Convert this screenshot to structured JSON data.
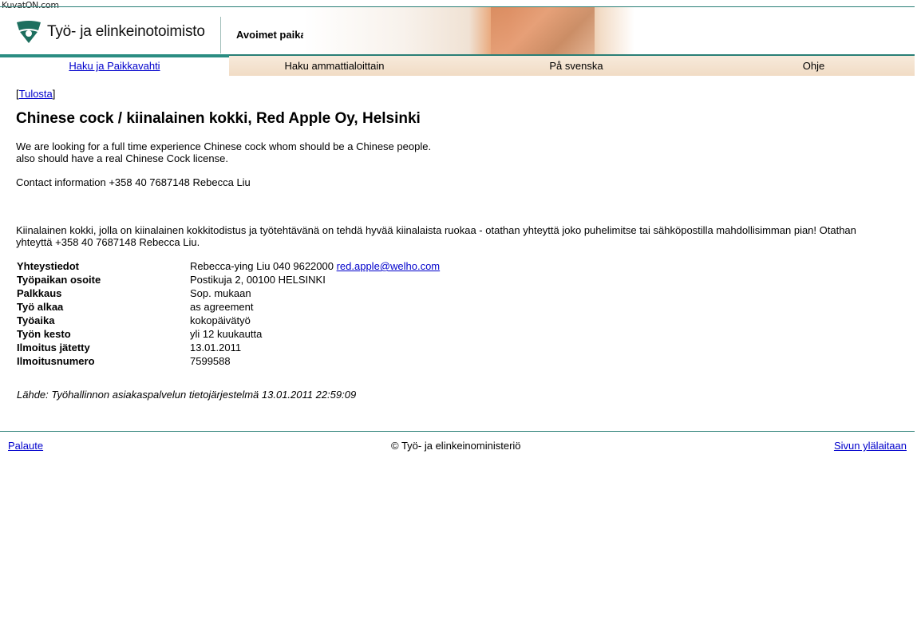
{
  "watermark": "KuvatON.com",
  "header": {
    "org_name": "Työ- ja elinkeinotoimisto",
    "section_title": "Avoimet paikat"
  },
  "nav": [
    {
      "label": "Haku ja Paikkavahti",
      "active": true
    },
    {
      "label": "Haku ammattialoittain",
      "active": false
    },
    {
      "label": "På svenska",
      "active": false
    },
    {
      "label": "Ohje",
      "active": false
    }
  ],
  "print": {
    "open": "[",
    "label": "Tulosta",
    "close": "]"
  },
  "title": "Chinese cock / kiinalainen kokki, Red Apple Oy, Helsinki",
  "description": {
    "line1": "We are looking for a full time experience Chinese cock whom should be a Chinese people.",
    "line2": "also should have a real Chinese Cock license.",
    "contact": "Contact information +358 40 7687148 Rebecca Liu",
    "finnish_line1": "Kiinalainen kokki, jolla on kiinalainen kokkitodistus ja työtehtävänä on tehdä hyvää kiinalaista ruokaa - otathan yhteyttä joko puhelimitse tai sähköpostilla mahdollisimman pian! Otathan",
    "finnish_line2": "yhteyttä +358 40 7687148 Rebecca Liu."
  },
  "details": {
    "contact_label": "Yhteystiedot",
    "contact_value": "Rebecca-ying Liu 040 9622000 ",
    "contact_email": "red.apple@welho.com",
    "rows": [
      {
        "label": "Työpaikan osoite",
        "value": "Postikuja 2, 00100 HELSINKI"
      },
      {
        "label": "Palkkaus",
        "value": "Sop. mukaan"
      },
      {
        "label": "Työ alkaa",
        "value": "as agreement"
      },
      {
        "label": "Työaika",
        "value": "kokopäivätyö"
      },
      {
        "label": "Työn kesto",
        "value": "yli 12 kuukautta"
      },
      {
        "label": "Ilmoitus jätetty",
        "value": "13.01.2011"
      },
      {
        "label": "Ilmoitusnumero",
        "value": "7599588"
      }
    ]
  },
  "source": "Lähde: Työhallinnon asiakaspalvelun tietojärjestelmä 13.01.2011 22:59:09",
  "footer": {
    "feedback": "Palaute",
    "copyright": "© Työ- ja elinkeinoministeriö",
    "top_link": "Sivun ylälaitaan"
  },
  "colors": {
    "accent": "#2a7f76",
    "nav_bg": "#f1dcc5",
    "link": "#0000cc"
  }
}
